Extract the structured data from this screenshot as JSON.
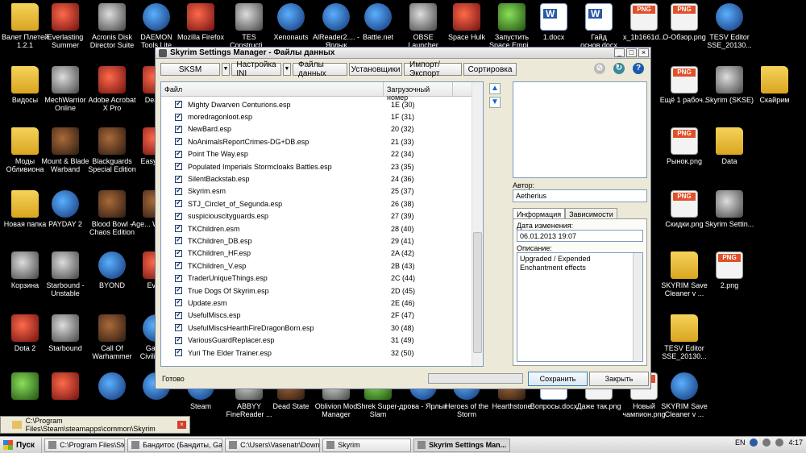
{
  "desktop_icons": [
    {
      "label": "Валет Плетей 1.2.1",
      "type": "folder"
    },
    {
      "label": "Everlasting Summer",
      "type": "red"
    },
    {
      "label": "Acronis Disk Director Suite",
      "type": "gray"
    },
    {
      "label": "DAEMON Tools Lite",
      "type": "blue"
    },
    {
      "label": "Mozilla Firefox",
      "type": "red"
    },
    {
      "label": "TES Constructi...",
      "type": "gray"
    },
    {
      "label": "Xenonauts",
      "type": "blue"
    },
    {
      "label": "AlReader2.... - Ярлык",
      "type": "blue"
    },
    {
      "label": "Battle.net",
      "type": "blue"
    },
    {
      "label": "OBSE Launcher",
      "type": "gray"
    },
    {
      "label": "Space Hulk",
      "type": "red"
    },
    {
      "label": "Запустить Space Empi...",
      "type": "green"
    },
    {
      "label": "1.docx",
      "type": "doc"
    },
    {
      "label": "Гайд основ.docx",
      "type": "doc"
    },
    {
      "label": "x_1b1661d...",
      "type": "png"
    },
    {
      "label": "О-Обзор.png",
      "type": "png"
    },
    {
      "label": "TESV Editor SSE_20130...",
      "type": "blue"
    },
    {
      "label": "Видосы",
      "type": "folder"
    },
    {
      "label": "MechWarrior Online",
      "type": "gray"
    },
    {
      "label": "Adobe Acrobat X Pro",
      "type": "red"
    },
    {
      "label": "Deac...",
      "type": "red"
    },
    {
      "label": "Ещё 1 рабоч...",
      "type": "png"
    },
    {
      "label": "Skyrim (SKSE)",
      "type": "gray"
    },
    {
      "label": "Скайрим",
      "type": "folder"
    },
    {
      "label": "Моды Обливиона",
      "type": "folder"
    },
    {
      "label": "Mount & Blade Warband",
      "type": "game"
    },
    {
      "label": "Blackguards Special Edition",
      "type": "game"
    },
    {
      "label": "EasyRe...",
      "type": "red"
    },
    {
      "label": "Рынок.png",
      "type": "png"
    },
    {
      "label": "Data",
      "type": "folder"
    },
    {
      "label": "Новая папка",
      "type": "folder"
    },
    {
      "label": "PAYDAY 2",
      "type": "blue"
    },
    {
      "label": "Blood Bowl - Chaos Edition",
      "type": "game"
    },
    {
      "label": "Age... Wonde...",
      "type": "game"
    },
    {
      "label": "Скидки.png",
      "type": "png"
    },
    {
      "label": "Skyrim Settin...",
      "type": "gray"
    },
    {
      "label": "Корзина",
      "type": "gray"
    },
    {
      "label": "Starbound - Unstable",
      "type": "gray"
    },
    {
      "label": "BYOND",
      "type": "blue"
    },
    {
      "label": "Evo...",
      "type": "red"
    },
    {
      "label": "SKYRIM Save Cleaner v ...",
      "type": "folder"
    },
    {
      "label": "2.png",
      "type": "png"
    },
    {
      "label": "Dota 2",
      "type": "red"
    },
    {
      "label": "Starbound",
      "type": "gray"
    },
    {
      "label": "Call Of Warhammer",
      "type": "game"
    },
    {
      "label": "Gala... Civilizati...",
      "type": "blue"
    },
    {
      "label": "TESV Editor SSE_20130...",
      "type": "folder"
    },
    {
      "label": "",
      "type": "green"
    },
    {
      "label": "",
      "type": "red"
    },
    {
      "label": "",
      "type": "blue"
    },
    {
      "label": "",
      "type": "blue"
    },
    {
      "label": "Steam",
      "type": "blue"
    },
    {
      "label": "ABBYY FineReader ...",
      "type": "gray"
    },
    {
      "label": "Dead State",
      "type": "game"
    },
    {
      "label": "Oblivion Mod Manager",
      "type": "gray"
    },
    {
      "label": "Shrek Super-Slam",
      "type": "green"
    },
    {
      "label": "дрова - Ярлык",
      "type": "blue"
    },
    {
      "label": "Heroes of the Storm",
      "type": "blue"
    },
    {
      "label": "Hearthstone",
      "type": "game"
    },
    {
      "label": "Вопросы.docx",
      "type": "doc"
    },
    {
      "label": "Даже так.png",
      "type": "png"
    },
    {
      "label": "Новый чампион.png",
      "type": "png"
    },
    {
      "label": "SKYRIM Save Cleaner v ...",
      "type": "blue"
    }
  ],
  "window": {
    "title": "Skyrim Settings Manager - Файлы данных",
    "toolbar": {
      "profile": "SKSM",
      "ini_settings": "Настройка INI",
      "data_files": "Файлы данных",
      "install": "Установщики",
      "import_export": "Импорт/Экспорт",
      "sort": "Сортировка"
    },
    "list": {
      "col_file": "Файл",
      "col_load": "Загрузочный номер",
      "rows": [
        {
          "name": "Mighty Dwarven Centurions.esp",
          "num": "1E (30)"
        },
        {
          "name": "moredragonloot.esp",
          "num": "1F (31)"
        },
        {
          "name": "NewBard.esp",
          "num": "20 (32)"
        },
        {
          "name": "NoAnimalsReportCrimes-DG+DB.esp",
          "num": "21 (33)"
        },
        {
          "name": "Point The Way.esp",
          "num": "22 (34)"
        },
        {
          "name": "Populated Imperials Stormcloaks Battles.esp",
          "num": "23 (35)"
        },
        {
          "name": "SilentBackstab.esp",
          "num": "24 (36)"
        },
        {
          "name": "Skyrim.esm",
          "num": "25 (37)"
        },
        {
          "name": "STJ_Circlet_of_Segunda.esp",
          "num": "26 (38)"
        },
        {
          "name": "suspiciouscityguards.esp",
          "num": "27 (39)"
        },
        {
          "name": "TKChildren.esm",
          "num": "28 (40)"
        },
        {
          "name": "TKChildren_DB.esp",
          "num": "29 (41)"
        },
        {
          "name": "TKChildren_HF.esp",
          "num": "2A (42)"
        },
        {
          "name": "TKChildren_V.esp",
          "num": "2B (43)"
        },
        {
          "name": "TraderUniqueThings.esp",
          "num": "2C (44)"
        },
        {
          "name": "True Dogs Of Skyrim.esp",
          "num": "2D (45)"
        },
        {
          "name": "Update.esm",
          "num": "2E (46)"
        },
        {
          "name": "UsefulMiscs.esp",
          "num": "2F (47)"
        },
        {
          "name": "UsefulMiscsHearthFireDragonBorn.esp",
          "num": "30 (48)"
        },
        {
          "name": "VariousGuardReplacer.esp",
          "num": "31 (49)"
        },
        {
          "name": "Yuri The Elder Trainer.esp",
          "num": "32 (50)"
        }
      ]
    },
    "details": {
      "author_label": "Автор:",
      "author_value": "Aetherius",
      "tab_info": "Информация",
      "tab_deps": "Зависимости",
      "modified_label": "Дата изменения:",
      "modified_value": "06.01.2013 19:07",
      "description_label": "Описание:",
      "description_value": "Upgraded / Expended Enchantment effects"
    },
    "status": "Готово",
    "save_label": "Сохранить",
    "close_label": "Закрыть"
  },
  "explorer_bar": {
    "path": "C:\\Program Files\\Steam\\steamapps\\common\\Skyrim"
  },
  "taskbar": {
    "start_label": "Пуск",
    "tasks": [
      {
        "label": "C:\\Program Files\\Steam\\...",
        "active": false
      },
      {
        "label": "Бандитос (Бандиты, Ga...",
        "active": false
      },
      {
        "label": "C:\\Users\\Vasenatr\\Down...",
        "active": false
      },
      {
        "label": "Skyrim",
        "active": false
      },
      {
        "label": "Skyrim Settings Man...",
        "active": true
      }
    ],
    "lang": "EN",
    "clock": "4:17"
  }
}
